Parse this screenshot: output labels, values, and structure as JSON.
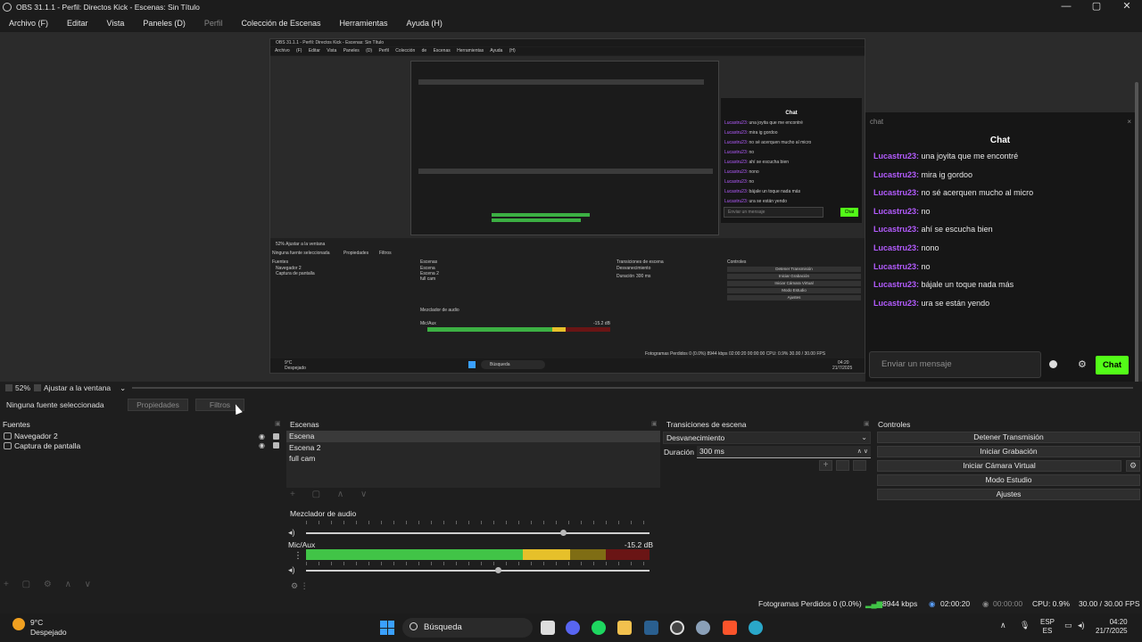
{
  "window": {
    "title": "OBS 31.1.1 - Perfil: Directos Kick - Escenas: Sin Título",
    "minimize": "—",
    "maximize": "▢",
    "close": "✕"
  },
  "menu": [
    "Archivo (F)",
    "Editar",
    "Vista",
    "Paneles (D)",
    "Perfil",
    "Colección de Escenas",
    "Herramientas",
    "Ayuda (H)"
  ],
  "inner_preview": {
    "title": "OBS 31.1.1 - Perfil: Directos Kick - Escenas: Sin Título",
    "menu": "Archivo (F) Editar Vista Paneles (D) Perfil Colección de Escenas Herramientas Ayuda (H)",
    "chat_title": "Chat",
    "chat_lines": [
      {
        "user": "Lucastru23:",
        "text": " una joyita que me encontré"
      },
      {
        "user": "Lucastru23:",
        "text": " mira ig gordoo"
      },
      {
        "user": "Lucastru23:",
        "text": " no sé acerquen mucho al micro"
      },
      {
        "user": "Lucastru23:",
        "text": " no"
      },
      {
        "user": "Lucastru23:",
        "text": " ahí se escucha bien"
      },
      {
        "user": "Lucastru23:",
        "text": " nono"
      },
      {
        "user": "Lucastru23:",
        "text": " no"
      },
      {
        "user": "Lucastru23:",
        "text": " bájale un toque nada más"
      },
      {
        "user": "Lucastru23:",
        "text": " ura se están yendo"
      }
    ],
    "chat_placeholder": "Enviar un mensaje",
    "chat_button": "Chat",
    "zoom": "52%   Ajustar a la ventana",
    "no_source": "Ninguna fuente seleccionada",
    "props": "Propiedades",
    "filters": "Filtros",
    "sources_h": "Fuentes",
    "src1": "Navegador 2",
    "src2": "Captura de pantalla",
    "scenes_h": "Escenas",
    "scene1": "Escena",
    "scene2": "Escena 2",
    "scene3": "full cam",
    "trans_h": "Transiciones de escena",
    "trans_sel": "Desvanecimiento",
    "dur": "Duración",
    "dur_val": "300 ms",
    "ctrl_h": "Controles",
    "ctrl1": "Detener Transmisión",
    "ctrl2": "Iniciar Grabación",
    "ctrl3": "Iniciar Cámara Virtual",
    "ctrl4": "Modo Estudio",
    "ctrl5": "Ajustes",
    "mixer_h": "Mezclador de audio",
    "mic": "Mic/Aux",
    "db": "-15.2 dB",
    "status": "Fotogramas Perdidos 0 (0.0%)   8944 kbps   02:00:20   00:00:00   CPU: 0.9%   30.00 / 30.00 FPS",
    "search": "Búsqueda",
    "temp": "9°C",
    "sky": "Despejado",
    "time": "04:20",
    "date": "21/7/2025"
  },
  "chat_dock": {
    "dock_title": "chat",
    "close": "×",
    "header": "Chat",
    "messages": [
      {
        "user": "Lucastru23:",
        "text": " una joyita que me encontré"
      },
      {
        "user": "Lucastru23:",
        "text": " mira ig gordoo"
      },
      {
        "user": "Lucastru23:",
        "text": " no sé acerquen mucho al micro"
      },
      {
        "user": "Lucastru23:",
        "text": " no"
      },
      {
        "user": "Lucastru23:",
        "text": " ahí se escucha bien"
      },
      {
        "user": "Lucastru23:",
        "text": " nono"
      },
      {
        "user": "Lucastru23:",
        "text": " no"
      },
      {
        "user": "Lucastru23:",
        "text": " bájale un toque nada más"
      },
      {
        "user": "Lucastru23:",
        "text": " ura se están yendo"
      }
    ],
    "placeholder": "Enviar un mensaje",
    "send": "Chat",
    "gear": "⚙",
    "user_color": "#b45cff",
    "send_color": "#53fc18"
  },
  "zoom": {
    "percent": "52%",
    "mode": "Ajustar a la ventana",
    "chevron": "⌄"
  },
  "source_toolbar": {
    "no_source": "Ninguna fuente seleccionada",
    "properties": "Propiedades",
    "filters": "Filtros"
  },
  "sources": {
    "header": "Fuentes",
    "items": [
      {
        "name": "Navegador 2",
        "visible": "◉"
      },
      {
        "name": "Captura de pantalla",
        "visible": "◉"
      }
    ],
    "tools": "+ ▢ ⚙ ∧ ∨"
  },
  "scenes": {
    "header": "Escenas",
    "items": [
      "Escena",
      "Escena 2",
      "full cam"
    ],
    "active_index": 0,
    "tools": "+ ▢ ∧ ∨"
  },
  "mixer": {
    "header": "Mezclador de audio",
    "channel": "Mic/Aux",
    "db": "-15.2 dB",
    "level_fraction": 0.77,
    "volume_fraction": 0.74,
    "monitor_fraction": 0.55
  },
  "transitions": {
    "header": "Transiciones de escena",
    "selected": "Desvanecimiento",
    "duration_label": "Duración",
    "duration_value": "300 ms",
    "add": "+"
  },
  "controls": {
    "header": "Controles",
    "buttons": [
      "Detener Transmisión",
      "Iniciar Grabación",
      "Iniciar Cámara Virtual",
      "Modo Estudio",
      "Ajustes"
    ],
    "gear": "⚙"
  },
  "status": {
    "dropped": "Fotogramas Perdidos 0 (0.0%)",
    "bitrate": "8944 kbps",
    "stream_time": "02:00:20",
    "rec_time": "00:00:00",
    "cpu": "CPU: 0.9%",
    "fps": "30.00 / 30.00 FPS"
  },
  "taskbar": {
    "temperature": "9°C",
    "weather": "Despejado",
    "search": "Búsqueda",
    "lang1": "ESP",
    "lang2": "ES",
    "time": "04:20",
    "date": "21/7/2025"
  }
}
